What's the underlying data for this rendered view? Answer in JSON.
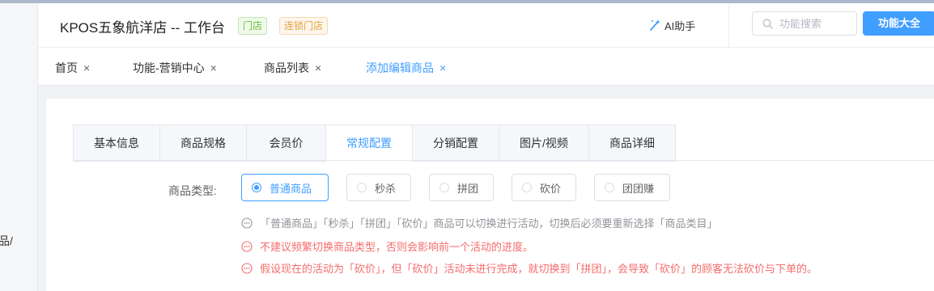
{
  "sidebar": {
    "fragment_text": "品/"
  },
  "header": {
    "store_title": "KPOS五象航洋店 -- 工作台",
    "tag_store": "门店",
    "tag_chain": "连锁门店",
    "ai_label": "AI助手",
    "search_placeholder": "功能搜索",
    "all_functions_label": "功能大全"
  },
  "page_tabs": [
    {
      "label": "首页",
      "close": "×"
    },
    {
      "label": "功能-营销中心",
      "close": "×"
    },
    {
      "label": "商品列表",
      "close": "×"
    },
    {
      "label": "添加编辑商品",
      "close": "×"
    }
  ],
  "sub_tabs": [
    "基本信息",
    "商品规格",
    "会员价",
    "常规配置",
    "分销配置",
    "图片/视频",
    "商品详细"
  ],
  "form": {
    "type_label": "商品类型:",
    "options": [
      "普通商品",
      "秒杀",
      "拼团",
      "砍价",
      "团团赚"
    ],
    "selected": "普通商品"
  },
  "notes": [
    "「普通商品」「秒杀」「拼团」「砍价」商品可以切换进行活动，切换后必须要重新选择「商品类目」",
    "不建议频繁切换商品类型，否则会影响前一个活动的进度。",
    "假设现在的活动为「砍价」，但「砍价」活动未进行完成，就切换到「拼团」，会导致「砍价」的顾客无法砍价与下单的。"
  ],
  "colors": {
    "accent": "#409eff",
    "store_tag": "#67c23a",
    "chain_tag": "#e6a23c",
    "warning": "#f56c6c",
    "info": "#909399"
  },
  "icons": {
    "ai": "magic-wand-icon",
    "search": "search-icon",
    "close": "close-icon",
    "note": "ellipsis-circle-icon"
  }
}
